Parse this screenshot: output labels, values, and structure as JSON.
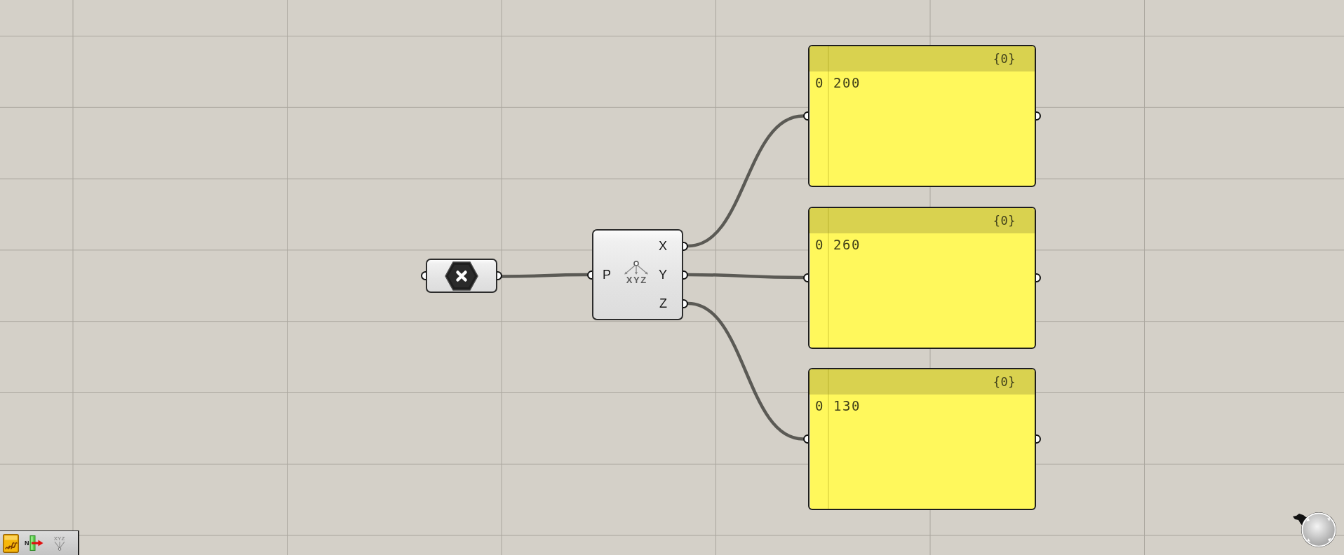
{
  "deconstruct_node": {
    "inputs": [
      "P"
    ],
    "outputs": [
      "X",
      "Y",
      "Z"
    ],
    "icon_label": "XYZ"
  },
  "panels": [
    {
      "path": "{0}",
      "items": [
        {
          "index": "0",
          "value": "200"
        }
      ]
    },
    {
      "path": "{0}",
      "items": [
        {
          "index": "0",
          "value": "260"
        }
      ]
    },
    {
      "path": "{0}",
      "items": [
        {
          "index": "0",
          "value": "130"
        }
      ]
    }
  ],
  "toolbar": [
    {
      "kind": "waves"
    },
    {
      "kind": "arrow",
      "label": "N"
    },
    {
      "kind": "tree",
      "label": "XYZ"
    }
  ]
}
